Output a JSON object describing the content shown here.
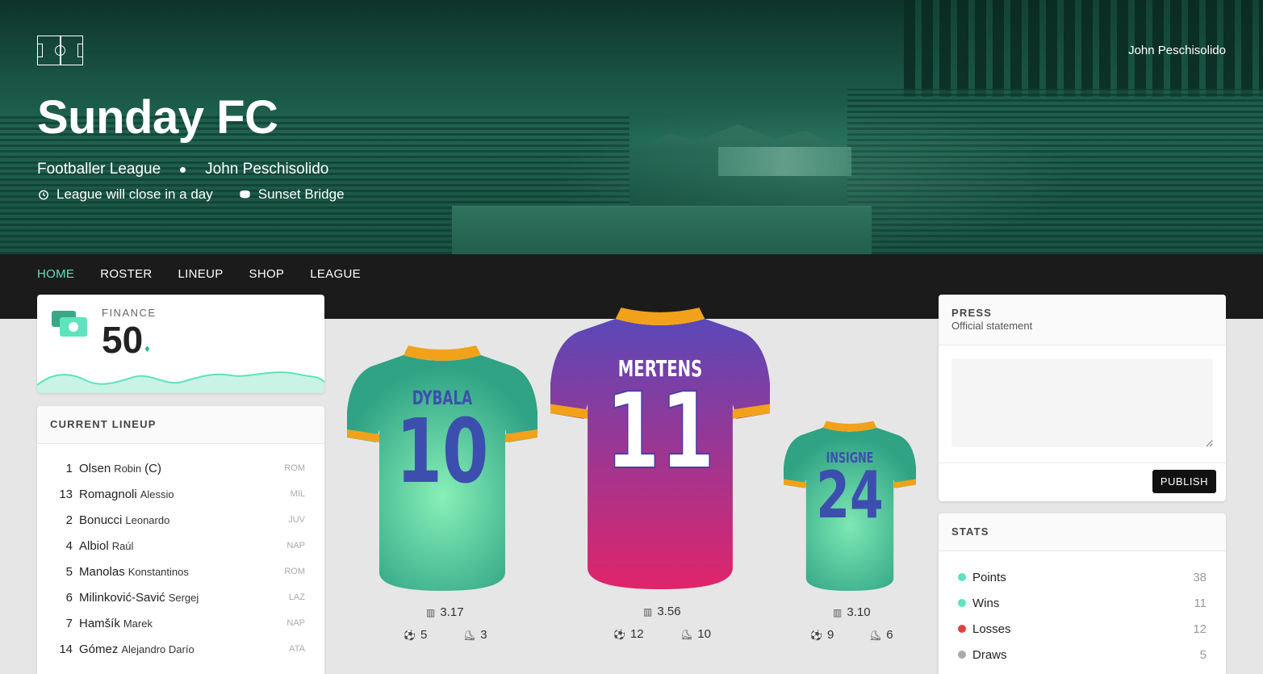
{
  "header": {
    "user": "John Peschisolido",
    "team_name": "Sunday FC",
    "league": "Footballer League",
    "owner": "John Peschisolido",
    "close_note": "League will close in a day",
    "stadium": "Sunset Bridge"
  },
  "nav": {
    "items": [
      "HOME",
      "ROSTER",
      "LINEUP",
      "SHOP",
      "LEAGUE"
    ],
    "active": "HOME"
  },
  "finance": {
    "label": "FINANCE",
    "value": "50",
    "currency_symbol": "♦"
  },
  "lineup": {
    "title": "CURRENT LINEUP",
    "players": [
      {
        "num": "1",
        "last": "Olsen",
        "first": "Robin",
        "captain": "(C)",
        "club": "ROM"
      },
      {
        "num": "13",
        "last": "Romagnoli",
        "first": "Alessio",
        "captain": "",
        "club": "MIL"
      },
      {
        "num": "2",
        "last": "Bonucci",
        "first": "Leonardo",
        "captain": "",
        "club": "JUV"
      },
      {
        "num": "4",
        "last": "Albiol",
        "first": "Raúl",
        "captain": "",
        "club": "NAP"
      },
      {
        "num": "5",
        "last": "Manolas",
        "first": "Konstantinos",
        "captain": "",
        "club": "ROM"
      },
      {
        "num": "6",
        "last": "Milinković-Savić",
        "first": "Sergej",
        "captain": "",
        "club": "LAZ"
      },
      {
        "num": "7",
        "last": "Hamšík",
        "first": "Marek",
        "captain": "",
        "club": "NAP"
      },
      {
        "num": "14",
        "last": "Gómez",
        "first": "Alejandro Darío",
        "captain": "",
        "club": "ATA"
      }
    ]
  },
  "featured": [
    {
      "name": "DYBALA",
      "number": "10",
      "rating": "3.17",
      "goals": "5",
      "assists": "3"
    },
    {
      "name": "MERTENS",
      "number": "11",
      "rating": "3.56",
      "goals": "12",
      "assists": "10"
    },
    {
      "name": "INSIGNE",
      "number": "24",
      "rating": "3.10",
      "goals": "9",
      "assists": "6"
    }
  ],
  "press": {
    "title": "PRESS",
    "subtitle": "Official statement",
    "placeholder": "",
    "button": "PUBLISH"
  },
  "stats": {
    "title": "STATS",
    "rows": [
      {
        "label": "Points",
        "value": "38",
        "color": "#5de3bd"
      },
      {
        "label": "Wins",
        "value": "11",
        "color": "#5de3bd"
      },
      {
        "label": "Losses",
        "value": "12",
        "color": "#e0413a"
      },
      {
        "label": "Draws",
        "value": "5",
        "color": "#aaaaaa"
      }
    ]
  },
  "colors": {
    "accent": "#5de3bd",
    "green_jersey": "#2fa384",
    "purple_jersey": "#5a48b8",
    "pink_jersey": "#e0246a",
    "trim": "#f2a21a"
  }
}
